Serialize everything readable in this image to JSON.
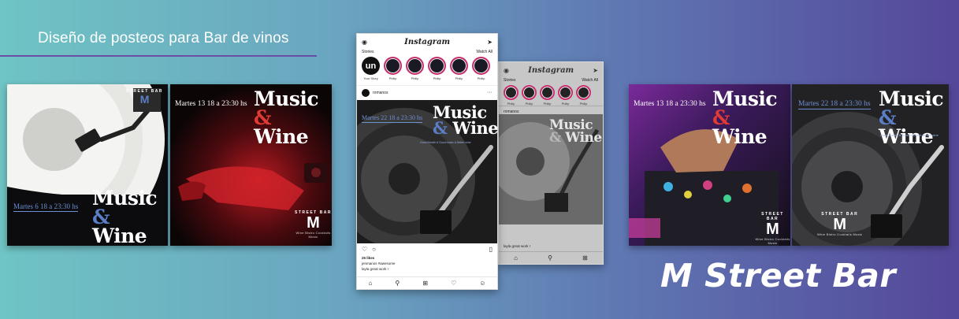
{
  "header": {
    "title": "Diseño de posteos para Bar de vinos"
  },
  "posts": {
    "music": "Music",
    "amp": "&",
    "wine": "Wine",
    "date_post1": "Martes 6 18 a 23:30 hs",
    "date_post2": "Martes 13 18 a 23:30 hs",
    "date_post3": "Martes 22 18 a 23:30 hs",
    "tagline": "Good Breath & Good music & Better wine",
    "logo_ring": "STREET BAR",
    "logo_letter": "M",
    "logo_sub": "Wine Bistro Cocktails Music"
  },
  "instagram": {
    "app_name": "Instagram",
    "stories_label": "Stories",
    "watch_all": "Watch All",
    "own_story_initials": "un",
    "own_story_label": "Your Story",
    "story_names": [
      "Philip",
      "Philip",
      "Philip",
      "Philip",
      "Philip"
    ],
    "account": "romanos",
    "likes": "25 likes",
    "caption": "jenmanos #awesome",
    "comment": "layla great work !"
  },
  "brand": {
    "name": "M Street Bar"
  },
  "colors": {
    "gradient_start": "#6fc4c4",
    "gradient_end": "#54479a",
    "accent_blue": "#5b7ec6",
    "accent_red": "#e03a35",
    "rule_purple": "#6b4fa6"
  }
}
